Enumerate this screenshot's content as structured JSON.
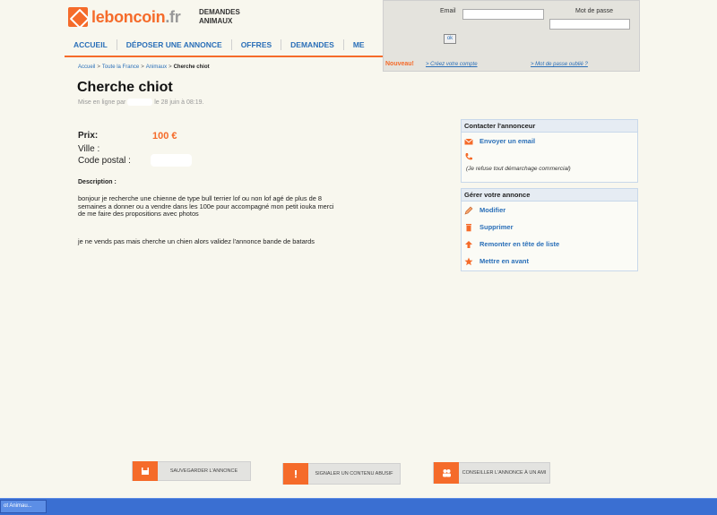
{
  "header": {
    "logo_main": "leboncoin",
    "logo_tld": ".fr",
    "section_tag": "DEMANDES ANIMAUX"
  },
  "nav": {
    "items": [
      "ACCUEIL",
      "DÉPOSER UNE ANNONCE",
      "OFFRES",
      "DEMANDES",
      "ME"
    ]
  },
  "login": {
    "email_label": "Email",
    "password_label": "Mot de passe",
    "email_value": "",
    "password_value": "",
    "ok_label": "ok",
    "nouveau": "Nouveau!",
    "create_account": "> Créez votre compte",
    "forgot_password": "> Mot de passe oublié ?"
  },
  "breadcrumb": {
    "items": [
      "Accueil",
      "Toute la France",
      "Animaux",
      "Cherche chiot"
    ],
    "separator": ">"
  },
  "ad": {
    "title": "Cherche chiot",
    "posted_prefix": "Mise en ligne par",
    "posted_suffix": "le 28 juin à 08:19.",
    "price_label": "Prix:",
    "price_value": "100 €",
    "city_label": "Ville :",
    "postal_label": "Code postal :",
    "description_label": "Description :",
    "description_paragraphs": [
      "bonjour je recherche une chienne de type bull terrier lof ou non lof agé de plus de 8 semaines a donner ou a vendre dans les 100e pour accompagné mon petit iouka merci de me faire des propositions avec photos",
      "je ne vends pas mais cherche un chien alors validez l'annonce bande de batards"
    ]
  },
  "contact_box": {
    "title": "Contacter l'annonceur",
    "email_action": "Envoyer un email",
    "note": "(Je refuse tout démarchage commercial)"
  },
  "manage_box": {
    "title": "Gérer votre annonce",
    "actions": [
      "Modifier",
      "Supprimer",
      "Remonter en tête de liste",
      "Mettre en avant"
    ]
  },
  "bottom_actions": [
    {
      "label": "SAUVEGARDER L'ANNONCE"
    },
    {
      "label": "SIGNALER UN CONTENU ABUSIF"
    },
    {
      "label": "CONSEILLER L'ANNONCE À UN AMI"
    }
  ],
  "taskbar": {
    "item": "ot Animau..."
  },
  "colors": {
    "brand_orange": "#f56b2a",
    "link_blue": "#2a6fb8",
    "taskbar_blue": "#3a6fd2"
  }
}
